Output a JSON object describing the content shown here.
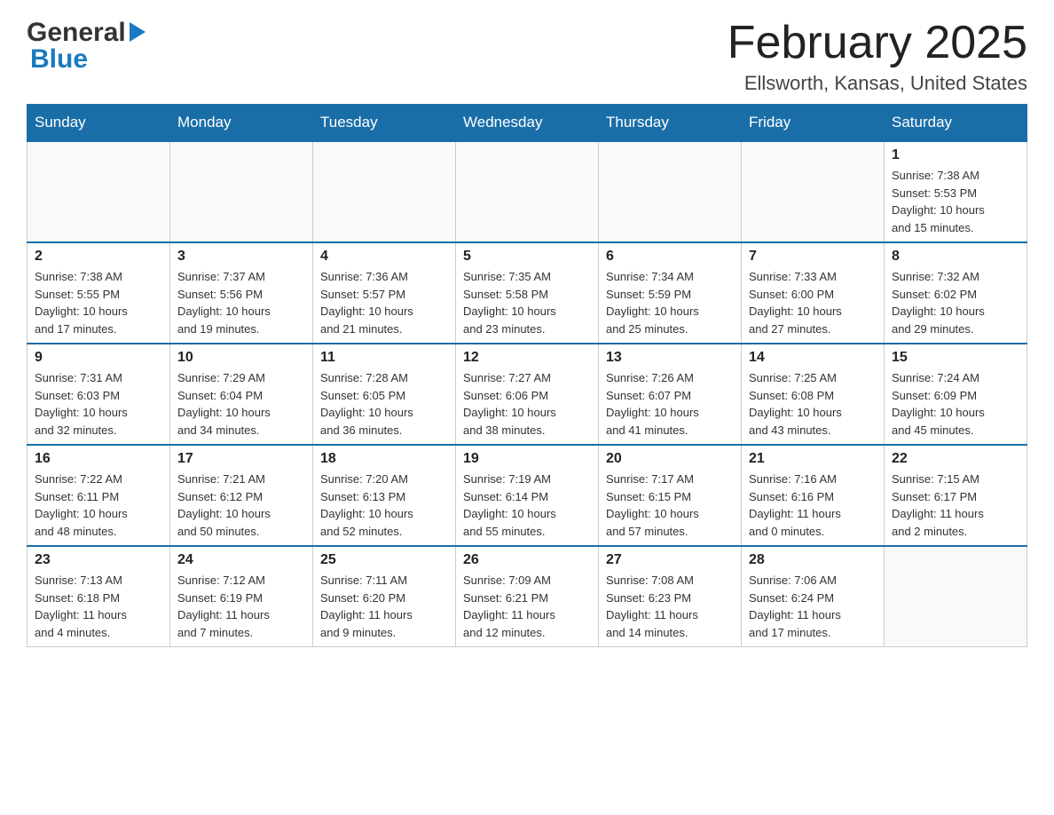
{
  "header": {
    "logo_general": "General",
    "logo_blue": "Blue",
    "title": "February 2025",
    "subtitle": "Ellsworth, Kansas, United States"
  },
  "days_of_week": [
    "Sunday",
    "Monday",
    "Tuesday",
    "Wednesday",
    "Thursday",
    "Friday",
    "Saturday"
  ],
  "weeks": [
    [
      {
        "day": "",
        "info": ""
      },
      {
        "day": "",
        "info": ""
      },
      {
        "day": "",
        "info": ""
      },
      {
        "day": "",
        "info": ""
      },
      {
        "day": "",
        "info": ""
      },
      {
        "day": "",
        "info": ""
      },
      {
        "day": "1",
        "info": "Sunrise: 7:38 AM\nSunset: 5:53 PM\nDaylight: 10 hours\nand 15 minutes."
      }
    ],
    [
      {
        "day": "2",
        "info": "Sunrise: 7:38 AM\nSunset: 5:55 PM\nDaylight: 10 hours\nand 17 minutes."
      },
      {
        "day": "3",
        "info": "Sunrise: 7:37 AM\nSunset: 5:56 PM\nDaylight: 10 hours\nand 19 minutes."
      },
      {
        "day": "4",
        "info": "Sunrise: 7:36 AM\nSunset: 5:57 PM\nDaylight: 10 hours\nand 21 minutes."
      },
      {
        "day": "5",
        "info": "Sunrise: 7:35 AM\nSunset: 5:58 PM\nDaylight: 10 hours\nand 23 minutes."
      },
      {
        "day": "6",
        "info": "Sunrise: 7:34 AM\nSunset: 5:59 PM\nDaylight: 10 hours\nand 25 minutes."
      },
      {
        "day": "7",
        "info": "Sunrise: 7:33 AM\nSunset: 6:00 PM\nDaylight: 10 hours\nand 27 minutes."
      },
      {
        "day": "8",
        "info": "Sunrise: 7:32 AM\nSunset: 6:02 PM\nDaylight: 10 hours\nand 29 minutes."
      }
    ],
    [
      {
        "day": "9",
        "info": "Sunrise: 7:31 AM\nSunset: 6:03 PM\nDaylight: 10 hours\nand 32 minutes."
      },
      {
        "day": "10",
        "info": "Sunrise: 7:29 AM\nSunset: 6:04 PM\nDaylight: 10 hours\nand 34 minutes."
      },
      {
        "day": "11",
        "info": "Sunrise: 7:28 AM\nSunset: 6:05 PM\nDaylight: 10 hours\nand 36 minutes."
      },
      {
        "day": "12",
        "info": "Sunrise: 7:27 AM\nSunset: 6:06 PM\nDaylight: 10 hours\nand 38 minutes."
      },
      {
        "day": "13",
        "info": "Sunrise: 7:26 AM\nSunset: 6:07 PM\nDaylight: 10 hours\nand 41 minutes."
      },
      {
        "day": "14",
        "info": "Sunrise: 7:25 AM\nSunset: 6:08 PM\nDaylight: 10 hours\nand 43 minutes."
      },
      {
        "day": "15",
        "info": "Sunrise: 7:24 AM\nSunset: 6:09 PM\nDaylight: 10 hours\nand 45 minutes."
      }
    ],
    [
      {
        "day": "16",
        "info": "Sunrise: 7:22 AM\nSunset: 6:11 PM\nDaylight: 10 hours\nand 48 minutes."
      },
      {
        "day": "17",
        "info": "Sunrise: 7:21 AM\nSunset: 6:12 PM\nDaylight: 10 hours\nand 50 minutes."
      },
      {
        "day": "18",
        "info": "Sunrise: 7:20 AM\nSunset: 6:13 PM\nDaylight: 10 hours\nand 52 minutes."
      },
      {
        "day": "19",
        "info": "Sunrise: 7:19 AM\nSunset: 6:14 PM\nDaylight: 10 hours\nand 55 minutes."
      },
      {
        "day": "20",
        "info": "Sunrise: 7:17 AM\nSunset: 6:15 PM\nDaylight: 10 hours\nand 57 minutes."
      },
      {
        "day": "21",
        "info": "Sunrise: 7:16 AM\nSunset: 6:16 PM\nDaylight: 11 hours\nand 0 minutes."
      },
      {
        "day": "22",
        "info": "Sunrise: 7:15 AM\nSunset: 6:17 PM\nDaylight: 11 hours\nand 2 minutes."
      }
    ],
    [
      {
        "day": "23",
        "info": "Sunrise: 7:13 AM\nSunset: 6:18 PM\nDaylight: 11 hours\nand 4 minutes."
      },
      {
        "day": "24",
        "info": "Sunrise: 7:12 AM\nSunset: 6:19 PM\nDaylight: 11 hours\nand 7 minutes."
      },
      {
        "day": "25",
        "info": "Sunrise: 7:11 AM\nSunset: 6:20 PM\nDaylight: 11 hours\nand 9 minutes."
      },
      {
        "day": "26",
        "info": "Sunrise: 7:09 AM\nSunset: 6:21 PM\nDaylight: 11 hours\nand 12 minutes."
      },
      {
        "day": "27",
        "info": "Sunrise: 7:08 AM\nSunset: 6:23 PM\nDaylight: 11 hours\nand 14 minutes."
      },
      {
        "day": "28",
        "info": "Sunrise: 7:06 AM\nSunset: 6:24 PM\nDaylight: 11 hours\nand 17 minutes."
      },
      {
        "day": "",
        "info": ""
      }
    ]
  ]
}
